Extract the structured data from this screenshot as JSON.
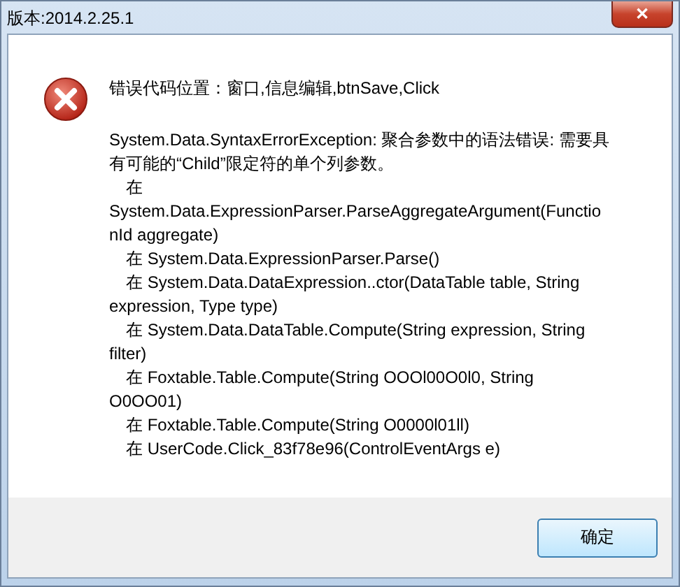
{
  "window": {
    "title": "版本:2014.2.25.1",
    "close_label": "✕"
  },
  "message": {
    "location": "错误代码位置：窗口,信息编辑,btnSave,Click",
    "lines": [
      {
        "kind": "wrap",
        "text": "System.Data.SyntaxErrorException: 聚合参数中的语法错误: 需要具"
      },
      {
        "kind": "wrap",
        "text": "有可能的“Child”限定符的单个列参数。"
      },
      {
        "kind": "frame",
        "text": "在"
      },
      {
        "kind": "wrap",
        "text": "System.Data.ExpressionParser.ParseAggregateArgument(Functio"
      },
      {
        "kind": "wrap",
        "text": "nId aggregate)"
      },
      {
        "kind": "frame",
        "text": "在 System.Data.ExpressionParser.Parse()"
      },
      {
        "kind": "frame",
        "text": "在 System.Data.DataExpression..ctor(DataTable table, String"
      },
      {
        "kind": "wrap",
        "text": "expression, Type type)"
      },
      {
        "kind": "frame",
        "text": "在 System.Data.DataTable.Compute(String expression, String"
      },
      {
        "kind": "wrap",
        "text": "filter)"
      },
      {
        "kind": "frame",
        "text": "在 Foxtable.Table.Compute(String OOOl00O0l0, String"
      },
      {
        "kind": "wrap",
        "text": "O0OO01)"
      },
      {
        "kind": "frame",
        "text": "在 Foxtable.Table.Compute(String O0000l01ll)"
      },
      {
        "kind": "frame",
        "text": "在 UserCode.Click_83f78e96(ControlEventArgs e)"
      }
    ]
  },
  "buttons": [
    {
      "label": "确定",
      "selected": true
    }
  ]
}
